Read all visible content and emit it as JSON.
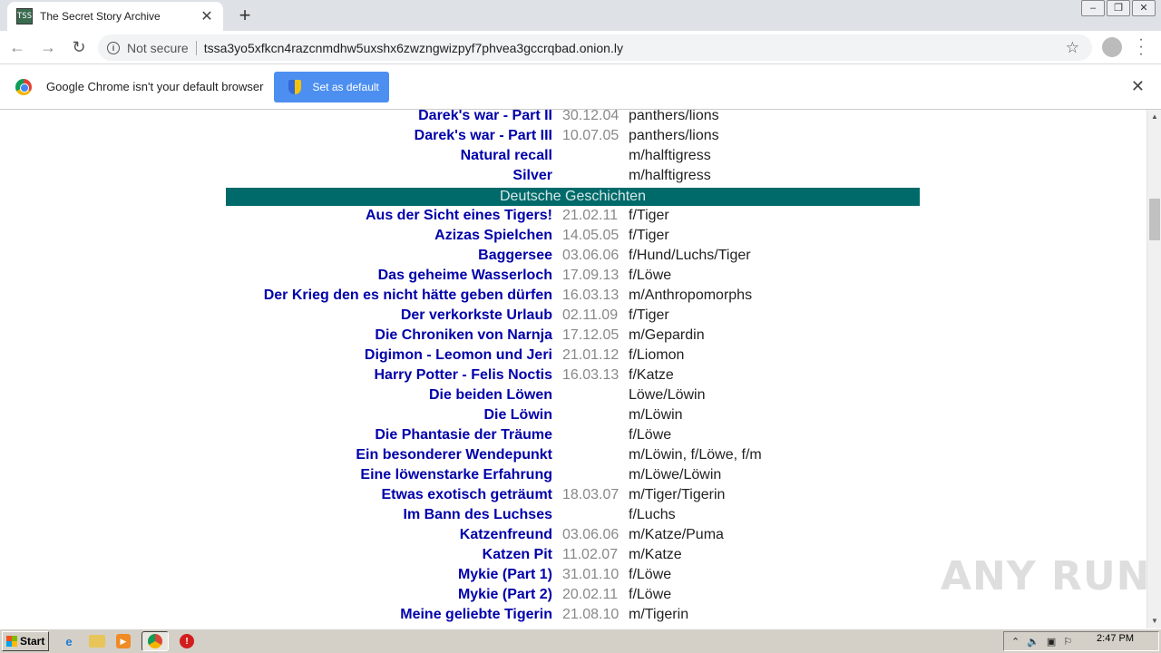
{
  "browser": {
    "tab_title": "The Secret Story Archive",
    "tab_favicon_text": "TSS",
    "new_tab_symbol": "+",
    "tab_close_symbol": "✕",
    "not_secure": "Not secure",
    "url": "tssa3yo5xfkcn4razcnmdhw5uxshx6zwzngwizpyf7phvea3gccrqbad.onion.ly",
    "infobar_text": "Google Chrome isn't your default browser",
    "set_default_label": "Set as default"
  },
  "rows_top": [
    {
      "title": "Darek's war - Part II",
      "date": "30.12.04",
      "tags": "panthers/lions"
    },
    {
      "title": "Darek's war - Part III",
      "date": "10.07.05",
      "tags": "panthers/lions"
    },
    {
      "title": "Natural recall",
      "date": "",
      "tags": "m/halftigress"
    },
    {
      "title": "Silver",
      "date": "",
      "tags": "m/halftigress"
    }
  ],
  "section_title": "Deutsche Geschichten",
  "rows_german": [
    {
      "title": "Aus der Sicht eines Tigers!",
      "date": "21.02.11",
      "tags": "f/Tiger"
    },
    {
      "title": "Azizas Spielchen",
      "date": "14.05.05",
      "tags": "f/Tiger"
    },
    {
      "title": "Baggersee",
      "date": "03.06.06",
      "tags": "f/Hund/Luchs/Tiger"
    },
    {
      "title": "Das geheime Wasserloch",
      "date": "17.09.13",
      "tags": "f/Löwe"
    },
    {
      "title": "Der Krieg den es nicht hätte geben dürfen",
      "date": "16.03.13",
      "tags": "m/Anthropomorphs"
    },
    {
      "title": "Der verkorkste Urlaub",
      "date": "02.11.09",
      "tags": "f/Tiger"
    },
    {
      "title": "Die Chroniken von Narnja",
      "date": "17.12.05",
      "tags": "m/Gepardin"
    },
    {
      "title": "Digimon - Leomon und Jeri",
      "date": "21.01.12",
      "tags": "f/Liomon"
    },
    {
      "title": "Harry Potter - Felis Noctis",
      "date": "16.03.13",
      "tags": "f/Katze"
    },
    {
      "title": "Die beiden Löwen",
      "date": "",
      "tags": "Löwe/Löwin"
    },
    {
      "title": "Die Löwin",
      "date": "",
      "tags": "m/Löwin"
    },
    {
      "title": "Die Phantasie der Träume",
      "date": "",
      "tags": "f/Löwe"
    },
    {
      "title": "Ein besonderer Wendepunkt",
      "date": "",
      "tags": "m/Löwin, f/Löwe, f/m"
    },
    {
      "title": "Eine löwenstarke Erfahrung",
      "date": "",
      "tags": "m/Löwe/Löwin"
    },
    {
      "title": "Etwas exotisch geträumt",
      "date": "18.03.07",
      "tags": "m/Tiger/Tigerin"
    },
    {
      "title": "Im Bann des Luchses",
      "date": "",
      "tags": "f/Luchs"
    },
    {
      "title": "Katzenfreund",
      "date": "03.06.06",
      "tags": "m/Katze/Puma"
    },
    {
      "title": "Katzen Pit",
      "date": "11.02.07",
      "tags": "m/Katze"
    },
    {
      "title": "Mykie (Part 1)",
      "date": "31.01.10",
      "tags": "f/Löwe"
    },
    {
      "title": "Mykie (Part 2)",
      "date": "20.02.11",
      "tags": "f/Löwe"
    },
    {
      "title": "Meine geliebte Tigerin",
      "date": "21.08.10",
      "tags": "m/Tigerin"
    }
  ],
  "watermark": "ANY RUN",
  "taskbar": {
    "start_label": "Start",
    "clock": "2:47 PM"
  },
  "colors": {
    "link": "#0000aa",
    "section_bg": "#006a6a",
    "date": "#888888"
  }
}
